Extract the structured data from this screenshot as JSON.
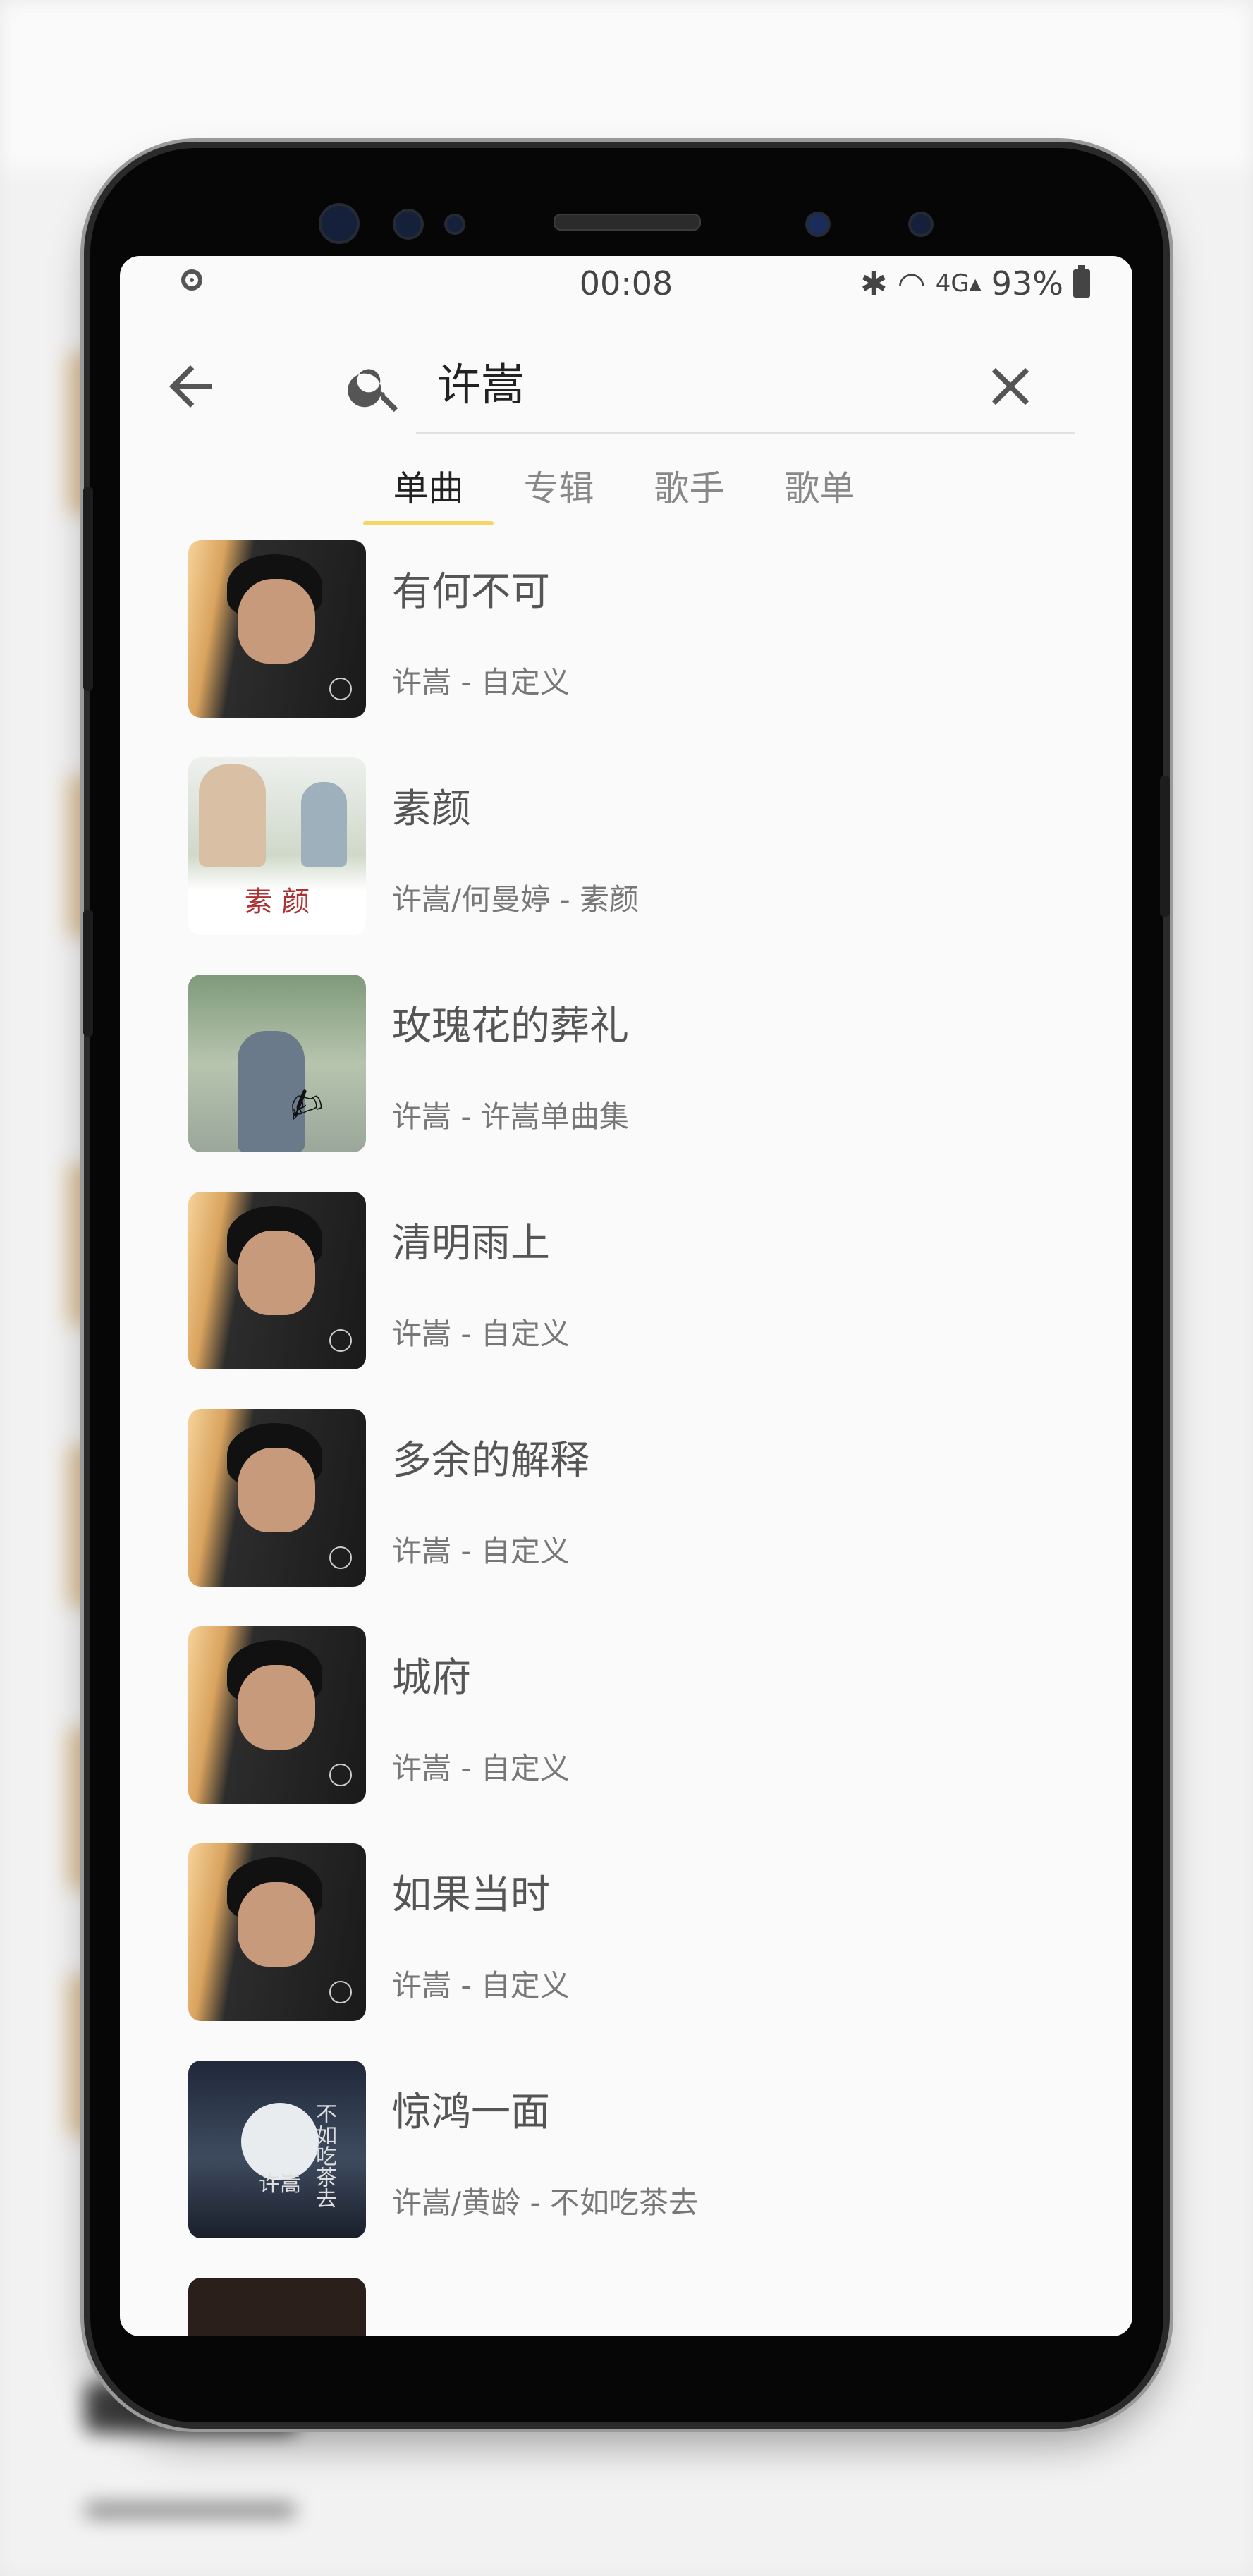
{
  "status_bar": {
    "time": "00:08",
    "battery": "93%",
    "icons": [
      "bluetooth-icon",
      "wifi-icon",
      "4g-signal-icon"
    ]
  },
  "search": {
    "query": "许嵩"
  },
  "tabs": [
    {
      "label": "单曲"
    },
    {
      "label": "专辑"
    },
    {
      "label": "歌手"
    },
    {
      "label": "歌单"
    }
  ],
  "songs": [
    {
      "title": "有何不可",
      "subtitle": "许嵩 - 自定义"
    },
    {
      "title": "素颜",
      "subtitle": "许嵩/何曼婷 - 素颜",
      "cover_text": "素 颜"
    },
    {
      "title": "玫瑰花的葬礼",
      "subtitle": "许嵩 - 许嵩单曲集"
    },
    {
      "title": "清明雨上",
      "subtitle": "许嵩 - 自定义"
    },
    {
      "title": "多余的解释",
      "subtitle": "许嵩 - 自定义"
    },
    {
      "title": "城府",
      "subtitle": "许嵩 - 自定义"
    },
    {
      "title": "如果当时",
      "subtitle": "许嵩 - 自定义"
    },
    {
      "title": "惊鸿一面",
      "subtitle": "许嵩/黄龄 - 不如吃茶去",
      "cover_text_1": "许嵩",
      "cover_text_2": "不如吃茶去"
    }
  ],
  "colors": {
    "tab_indicator": "#f5d665",
    "screen_bg": "#fafafa"
  }
}
